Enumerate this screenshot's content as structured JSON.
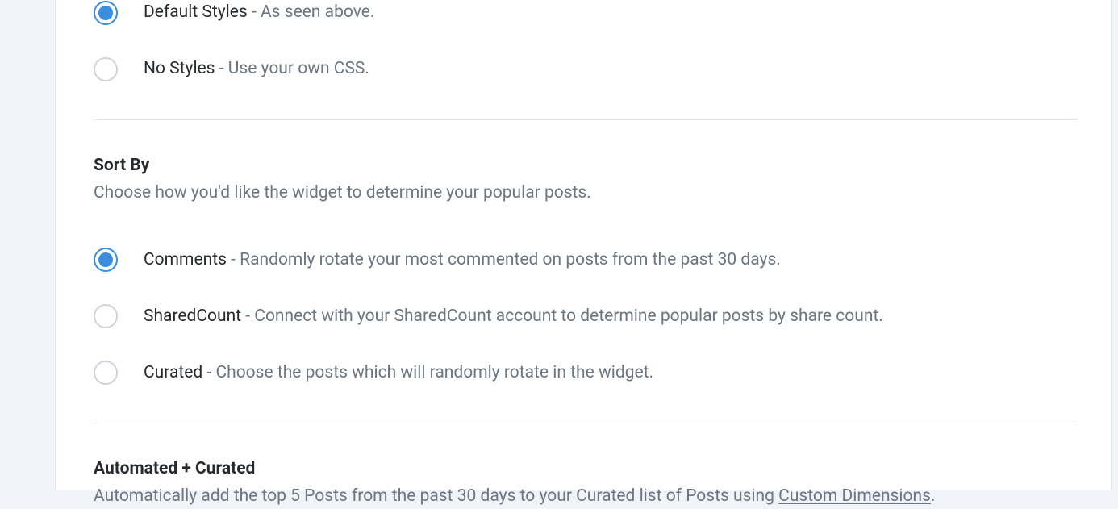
{
  "styles": {
    "options": [
      {
        "label": "Default Styles",
        "desc": " - As seen above.",
        "selected": true
      },
      {
        "label": "No Styles",
        "desc": " - Use your own CSS.",
        "selected": false
      }
    ]
  },
  "sort_by": {
    "title": "Sort By",
    "desc": "Choose how you'd like the widget to determine your popular posts.",
    "options": [
      {
        "label": "Comments",
        "desc": " - Randomly rotate your most commented on posts from the past 30 days.",
        "selected": true
      },
      {
        "label": "SharedCount",
        "desc": " - Connect with your SharedCount account to determine popular posts by share count.",
        "selected": false
      },
      {
        "label": "Curated",
        "desc": " - Choose the posts which will randomly rotate in the widget.",
        "selected": false
      }
    ]
  },
  "automated": {
    "title": "Automated + Curated",
    "desc_pre": "Automatically add the top 5 Posts from the past 30 days to your Curated list of Posts using ",
    "desc_link": "Custom Dimensions",
    "desc_post": "."
  }
}
